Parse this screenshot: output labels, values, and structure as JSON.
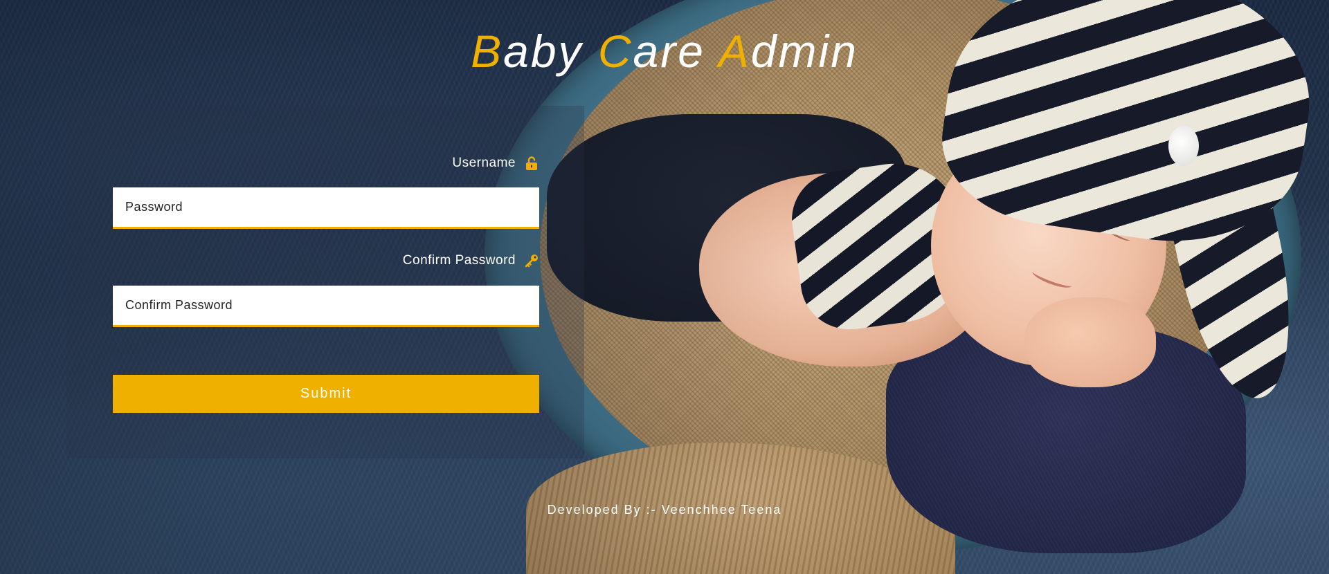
{
  "app": {
    "title_parts": [
      {
        "initial": "B",
        "rest": "aby "
      },
      {
        "initial": "C",
        "rest": "are "
      },
      {
        "initial": "A",
        "rest": "dmin"
      }
    ]
  },
  "form": {
    "username_label": "Username",
    "username_icon": "unlock-icon",
    "password_placeholder": "Password",
    "confirm_label": "Confirm Password",
    "confirm_icon": "key-icon",
    "confirm_placeholder": "Confirm Password",
    "submit_label": "Submit"
  },
  "footer": {
    "credit": "Developed By :- Veenchhee Teena"
  },
  "colors": {
    "accent": "#f0b000",
    "text_light": "#ffffff",
    "background": "#1e2e46"
  }
}
